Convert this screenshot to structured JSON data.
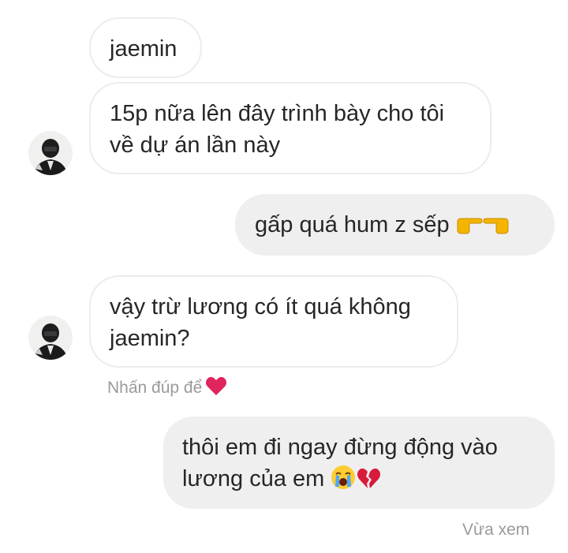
{
  "thread": {
    "messages": [
      {
        "sender": "them",
        "text": "jaemin"
      },
      {
        "sender": "them",
        "lines": [
          "15p nữa lên đây trình bày cho tôi",
          "về dự án lần này"
        ]
      },
      {
        "sender": "me",
        "text": "gấp quá hum z sếp",
        "emojis": [
          "backhand-index-pointing-right-icon",
          "backhand-index-pointing-left-icon"
        ]
      },
      {
        "sender": "them",
        "lines": [
          "vậy trừ lương có ít quá không",
          "jaemin?"
        ]
      },
      {
        "sender": "me",
        "lines": [
          "thôi em đi ngay đừng động vào",
          "lương của em"
        ],
        "emojis": [
          "loudly-crying-face-icon",
          "broken-heart-icon"
        ]
      }
    ],
    "double_tap_hint": "Nhấn đúp để",
    "seen_label": "Vừa xem"
  },
  "colors": {
    "sent_bubble": "#efefef",
    "received_border": "#ececec",
    "text": "#262626",
    "meta_text": "#9a9a9a",
    "heart": "#e0245e"
  }
}
